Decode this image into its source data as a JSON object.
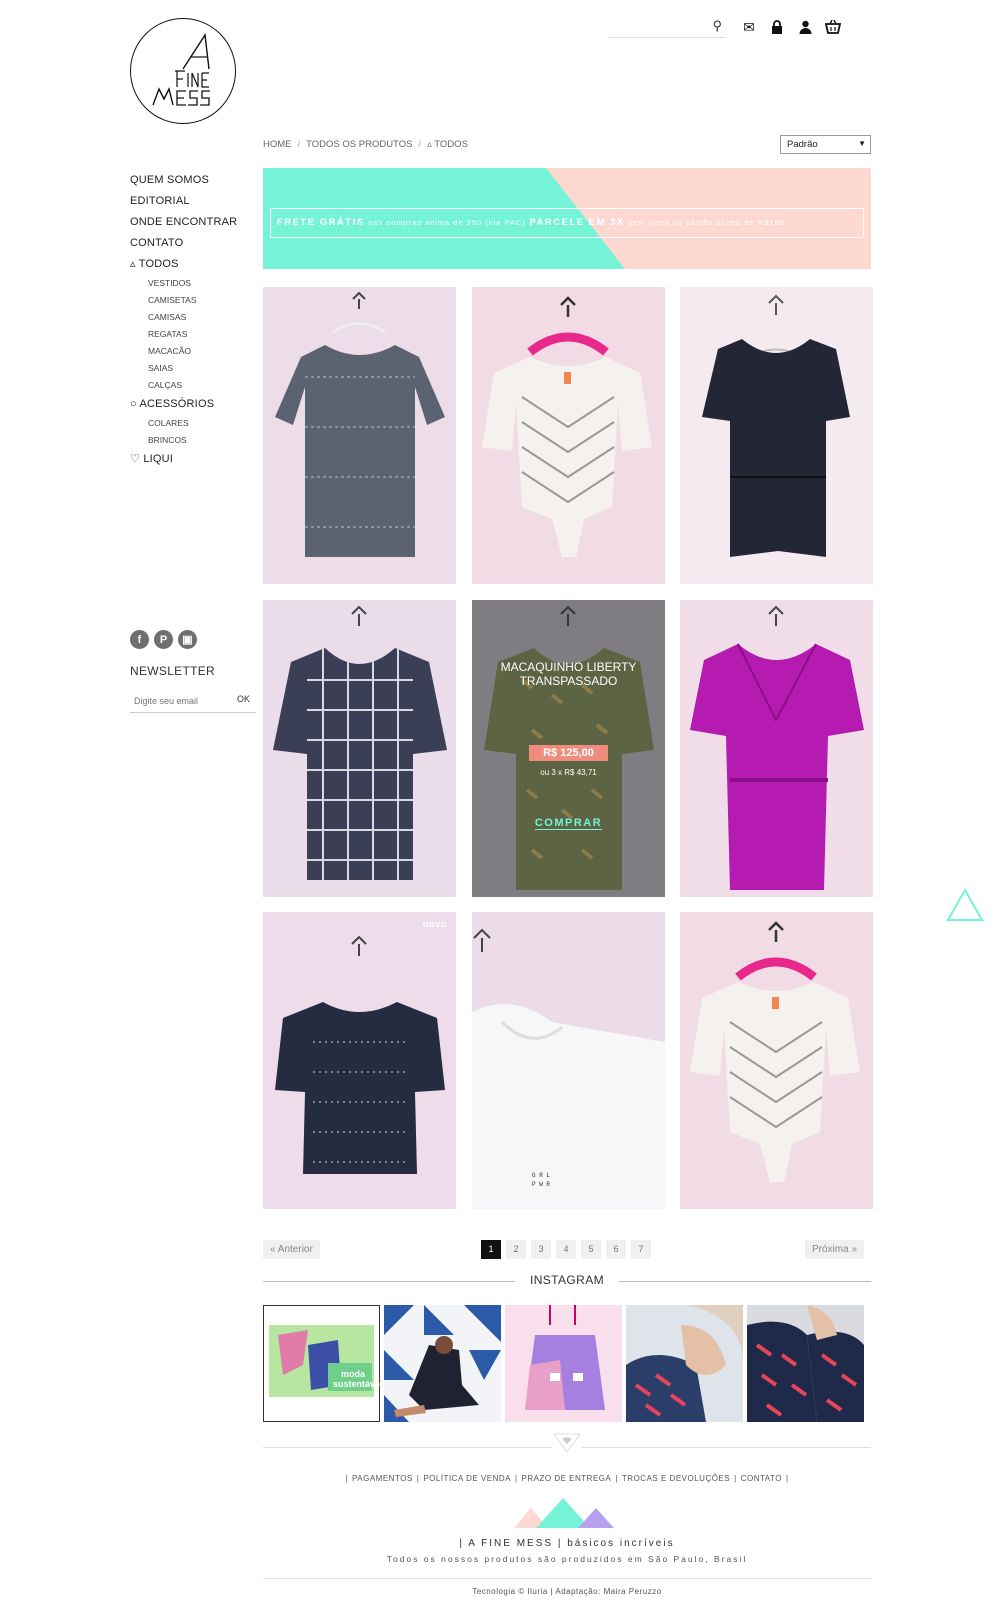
{
  "header": {
    "logo_text": [
      "A",
      "FINE",
      "MESS"
    ],
    "search_placeholder": "",
    "icons": [
      "search-icon",
      "envelope-icon",
      "lock-icon",
      "user-icon",
      "basket-icon"
    ]
  },
  "breadcrumb": {
    "home": "HOME",
    "all_products": "TODOS OS PRODUTOS",
    "current": "▵ TODOS"
  },
  "sort": {
    "selected": "Padrão"
  },
  "sidebar": {
    "main": [
      "QUEM SOMOS",
      "EDITORIAL",
      "ONDE ENCONTRAR",
      "CONTATO"
    ],
    "todos": "▵ TODOS",
    "todos_sub": [
      "VESTIDOS",
      "CAMISETAS",
      "CAMISAS",
      "REGATAS",
      "MACACÃO",
      "SAIAS",
      "CALÇAS"
    ],
    "acessorios": "○ ACESSÓRIOS",
    "acessorios_sub": [
      "COLARES",
      "BRINCOS"
    ],
    "liqui": "♡ LIQUI"
  },
  "social": {
    "facebook": "f",
    "pinterest": "P",
    "instagram": "▣"
  },
  "newsletter": {
    "title": "NEWSLETTER",
    "placeholder": "Digite seu email",
    "ok": "OK"
  },
  "banner": {
    "free_shipping": "FRETE GRÁTIS",
    "free_shipping_detail": "nas compras acima de 250 (via PAC)",
    "installments": "PARCELE EM 3X",
    "installments_detail": "sem juros no cartão acima de R$150",
    "colors": {
      "left": "#74f3d6",
      "right": "#fcd8d1"
    }
  },
  "products": {
    "hover": {
      "name": "MACAQUINHO LIBERTY TRANSPASSADO",
      "price": "R$ 125,00",
      "installments": "ou 3 x R$ 43,71",
      "buy": "COMPRAR"
    },
    "new_badge": "NOVO"
  },
  "pagination": {
    "prev": "« Anterior",
    "next": "Próxima »",
    "pages": [
      "1",
      "2",
      "3",
      "4",
      "5",
      "6",
      "7"
    ],
    "current": "1"
  },
  "instagram": {
    "title": "INSTAGRAM",
    "first_post_text": "moda sustentável"
  },
  "footer": {
    "links": [
      "PAGAMENTOS",
      "POLÍTICA DE VENDA",
      "PRAZO DE ENTREGA",
      "TROCAS E DEVOLUÇÕES",
      "CONTATO"
    ],
    "brand": "A FINE MESS",
    "brand_tagline": "básicos incríveis",
    "made_in": "Todos os nossos produtos são produzidos em São Paulo, Brasil",
    "tech": "Tecnologia © Iluria",
    "adapt": "Adaptação: Maira Peruzzo"
  },
  "colors": {
    "mint": "#74f3d6",
    "pink": "#fcd8d1",
    "price": "#f08c7d"
  }
}
